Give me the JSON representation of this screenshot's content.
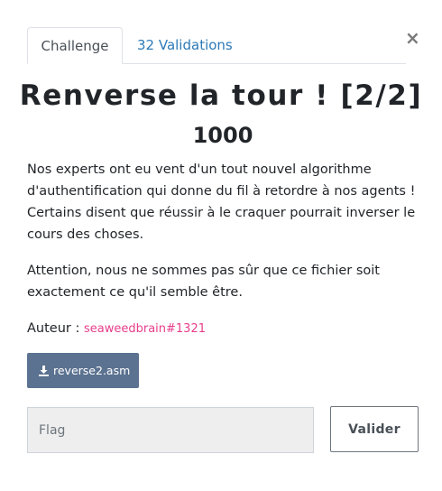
{
  "tabs": {
    "challenge_label": "Challenge",
    "validations_label": "32 Validations"
  },
  "close_label": "×",
  "challenge": {
    "title": "Renverse la tour ! [2/2]",
    "points": "1000",
    "description_1": "Nos experts ont eu vent d'un tout nouvel algorithme d'authentification qui donne du fil à retordre à nos agents ! Certains disent que réussir à le craquer pourrait inverser le cours des choses.",
    "description_2": "Attention, nous ne sommes pas sûr que ce fichier soit exactement ce qu'il semble être.",
    "author_label": "Auteur : ",
    "author_name": "seaweedbrain#1321",
    "file_name": "reverse2.asm"
  },
  "form": {
    "flag_placeholder": "Flag",
    "flag_value": "",
    "submit_label": "Valider"
  },
  "colors": {
    "tab_link": "#2c7ab8",
    "author_link": "#e83e8c",
    "download_button": "#5b7290"
  },
  "icons": {
    "download": "download-icon",
    "close": "close-icon"
  }
}
